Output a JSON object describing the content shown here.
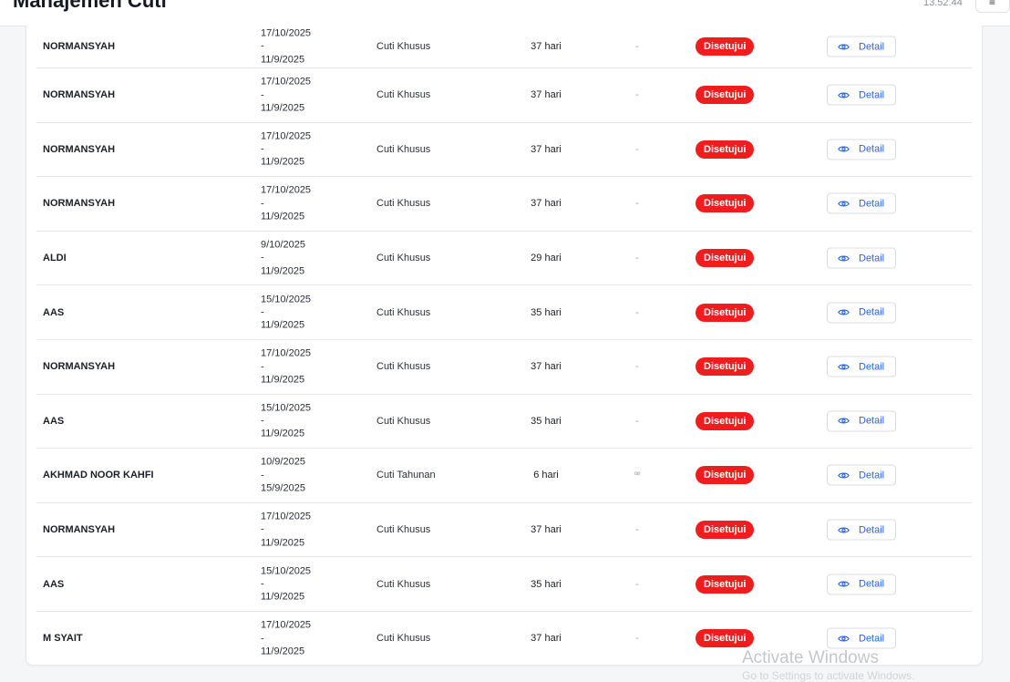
{
  "header": {
    "title": "Manajemen Cuti",
    "clock": "13.52.44",
    "button_icon": "menu-icon",
    "button_glyph": "≡"
  },
  "table": {
    "rows": [
      {
        "name": "NORMANSYAH",
        "start": "17/10/2025",
        "sep": "-",
        "end": "11/9/2025",
        "type": "Cuti Khusus",
        "duration": "37 hari",
        "note": "-",
        "status": "Disetujui",
        "action": "Detail"
      },
      {
        "name": "NORMANSYAH",
        "start": "17/10/2025",
        "sep": "-",
        "end": "11/9/2025",
        "type": "Cuti Khusus",
        "duration": "37 hari",
        "note": "-",
        "status": "Disetujui",
        "action": "Detail"
      },
      {
        "name": "NORMANSYAH",
        "start": "17/10/2025",
        "sep": "-",
        "end": "11/9/2025",
        "type": "Cuti Khusus",
        "duration": "37 hari",
        "note": "-",
        "status": "Disetujui",
        "action": "Detail"
      },
      {
        "name": "NORMANSYAH",
        "start": "17/10/2025",
        "sep": "-",
        "end": "11/9/2025",
        "type": "Cuti Khusus",
        "duration": "37 hari",
        "note": "-",
        "status": "Disetujui",
        "action": "Detail"
      },
      {
        "name": "ALDI",
        "start": "9/10/2025",
        "sep": "-",
        "end": "11/9/2025",
        "type": "Cuti Khusus",
        "duration": "29 hari",
        "note": "-",
        "status": "Disetujui",
        "action": "Detail"
      },
      {
        "name": "AAS",
        "start": "15/10/2025",
        "sep": "-",
        "end": "11/9/2025",
        "type": "Cuti Khusus",
        "duration": "35 hari",
        "note": "-",
        "status": "Disetujui",
        "action": "Detail"
      },
      {
        "name": "NORMANSYAH",
        "start": "17/10/2025",
        "sep": "-",
        "end": "11/9/2025",
        "type": "Cuti Khusus",
        "duration": "37 hari",
        "note": "-",
        "status": "Disetujui",
        "action": "Detail"
      },
      {
        "name": "AAS",
        "start": "15/10/2025",
        "sep": "-",
        "end": "11/9/2025",
        "type": "Cuti Khusus",
        "duration": "35 hari",
        "note": "-",
        "status": "Disetujui",
        "action": "Detail"
      },
      {
        "name": "AKHMAD NOOR KAHFI",
        "start": "10/9/2025",
        "sep": "-",
        "end": "15/9/2025",
        "type": "Cuti Tahunan",
        "duration": "6 hari",
        "note": "ꟹ",
        "status": "Disetujui",
        "action": "Detail"
      },
      {
        "name": "NORMANSYAH",
        "start": "17/10/2025",
        "sep": "-",
        "end": "11/9/2025",
        "type": "Cuti Khusus",
        "duration": "37 hari",
        "note": "-",
        "status": "Disetujui",
        "action": "Detail"
      },
      {
        "name": "AAS",
        "start": "15/10/2025",
        "sep": "-",
        "end": "11/9/2025",
        "type": "Cuti Khusus",
        "duration": "35 hari",
        "note": "-",
        "status": "Disetujui",
        "action": "Detail"
      },
      {
        "name": "M SYAIT",
        "start": "17/10/2025",
        "sep": "-",
        "end": "11/9/2025",
        "type": "Cuti Khusus",
        "duration": "37 hari",
        "note": "-",
        "status": "Disetujui",
        "action": "Detail"
      }
    ]
  },
  "colors": {
    "status_badge": "#ef1d1d",
    "action_text": "#2563eb"
  },
  "watermark": {
    "line1": "Activate Windows",
    "line2": "Go to Settings to activate Windows."
  }
}
